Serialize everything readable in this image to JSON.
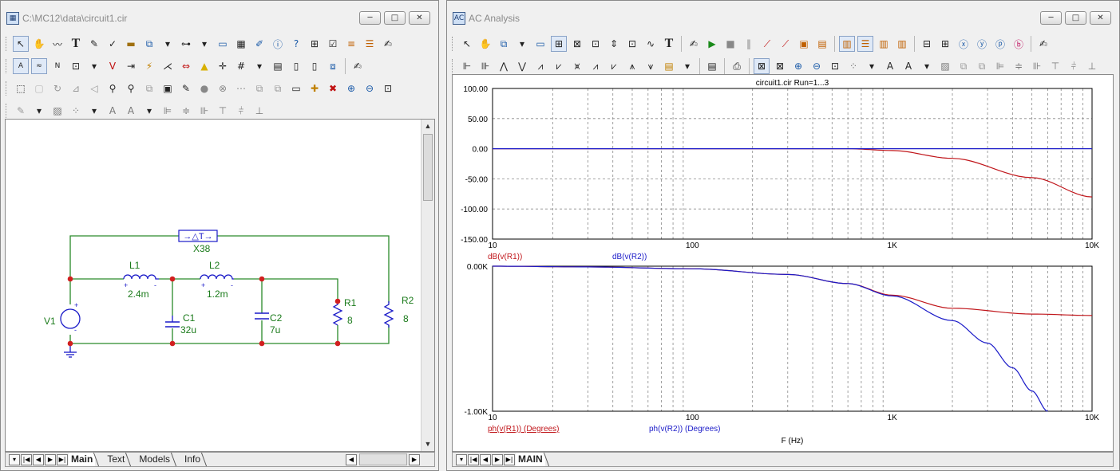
{
  "schematic_window": {
    "title": "C:\\MC12\\data\\circuit1.cir",
    "tabs": [
      "Main",
      "Text",
      "Models",
      "Info"
    ],
    "active_tab": "Main",
    "buttons": {
      "min": "─",
      "max": "□",
      "close": "✕"
    }
  },
  "schematic": {
    "components": {
      "L1": {
        "name": "L1",
        "value": "2.4m"
      },
      "L2": {
        "name": "L2",
        "value": "1.2m"
      },
      "C1": {
        "name": "C1",
        "value": "32u"
      },
      "C2": {
        "name": "C2",
        "value": "7u"
      },
      "R1": {
        "name": "R1",
        "value": "8"
      },
      "R2": {
        "name": "R2",
        "value": "8"
      },
      "V1": {
        "name": "V1"
      },
      "X38": {
        "name": "X38",
        "symbol": "→△T→"
      }
    },
    "colors": {
      "wire": "#2a8a2a",
      "node": "#d11f1f",
      "component": "#1a1ac8"
    }
  },
  "ac_window": {
    "title": "AC Analysis",
    "tabs": [
      "MAIN"
    ],
    "active_tab": "MAIN",
    "buttons": {
      "min": "─",
      "max": "□",
      "close": "✕"
    }
  },
  "chart_data": [
    {
      "type": "line",
      "title": "circuit1.cir Run=1...3",
      "x_scale": "log",
      "xlim": [
        10,
        10000
      ],
      "x_tick_labels": [
        "10",
        "100",
        "1K",
        "10K"
      ],
      "ylim": [
        -150,
        100
      ],
      "y_tick_labels": [
        "100.00",
        "50.00",
        "0.00",
        "-50.00",
        "-100.00",
        "-150.00"
      ],
      "series": [
        {
          "name": "dB(v(R1))",
          "color": "#c0161b",
          "x": [
            10,
            100,
            600,
            1000,
            2000,
            5000,
            10000
          ],
          "y": [
            0,
            0,
            0,
            -3,
            -16,
            -48,
            -80
          ]
        },
        {
          "name": "dB(v(R2))",
          "color": "#1a1ac8",
          "x": [
            10,
            10000
          ],
          "y": [
            0,
            0
          ]
        }
      ]
    },
    {
      "type": "line",
      "x_scale": "log",
      "xlim": [
        10,
        10000
      ],
      "x_tick_labels": [
        "10",
        "100",
        "1K",
        "10K"
      ],
      "ylim": [
        -1000,
        0
      ],
      "y_tick_labels": [
        "0.00K",
        "-1.00K"
      ],
      "xlabel": "F (Hz)",
      "series": [
        {
          "name": "ph(v(R1)) (Degrees)",
          "color": "#c0161b",
          "x": [
            10,
            30,
            100,
            300,
            600,
            1000,
            2000,
            5000,
            10000
          ],
          "y": [
            0,
            -5,
            -18,
            -57,
            -120,
            -200,
            -290,
            -330,
            -340
          ]
        },
        {
          "name": "ph(v(R2)) (Degrees)",
          "color": "#1a1ac8",
          "x": [
            10,
            30,
            100,
            300,
            600,
            1000,
            2000,
            3000,
            4000,
            5000,
            6000
          ],
          "y": [
            0,
            -5,
            -18,
            -57,
            -120,
            -205,
            -375,
            -530,
            -700,
            -860,
            -1000
          ]
        }
      ]
    }
  ]
}
